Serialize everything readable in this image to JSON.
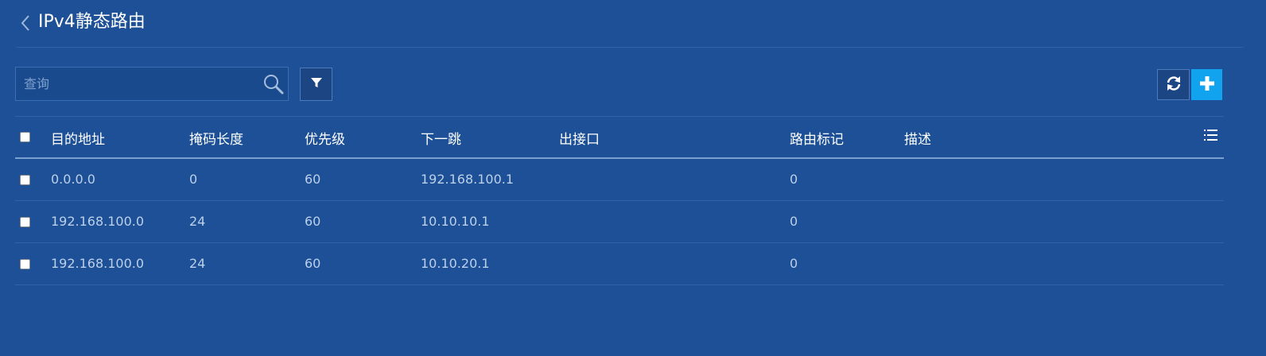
{
  "header": {
    "title": "IPv4静态路由"
  },
  "toolbar": {
    "search_placeholder": "查询"
  },
  "icons": {
    "back": "chevron-left-icon",
    "search": "search-icon",
    "filter": "filter-icon",
    "refresh": "refresh-icon",
    "add": "plus-icon",
    "columns": "list-columns-icon"
  },
  "colors": {
    "background": "#1d5096",
    "add_button": "#12a3ef",
    "row_text": "#bcd0ea"
  },
  "table": {
    "columns": [
      "目的地址",
      "掩码长度",
      "优先级",
      "下一跳",
      "出接口",
      "路由标记",
      "描述"
    ],
    "rows": [
      [
        "0.0.0.0",
        "0",
        "60",
        "192.168.100.1",
        "",
        "0",
        ""
      ],
      [
        "192.168.100.0",
        "24",
        "60",
        "10.10.10.1",
        "",
        "0",
        ""
      ],
      [
        "192.168.100.0",
        "24",
        "60",
        "10.10.20.1",
        "",
        "0",
        ""
      ]
    ]
  }
}
